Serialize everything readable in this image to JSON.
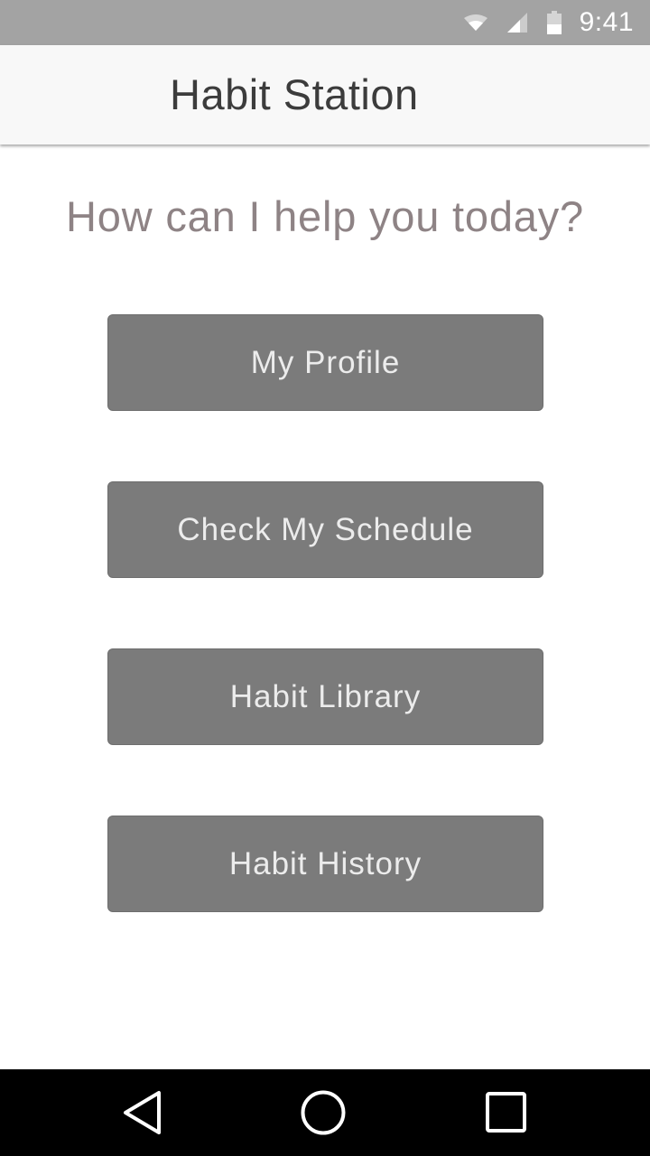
{
  "status_bar": {
    "time": "9:41",
    "icons": [
      "wifi-icon",
      "cell-signal-icon",
      "battery-icon"
    ]
  },
  "app_bar": {
    "title": "Habit Station"
  },
  "main": {
    "prompt": "How can I help you today?",
    "buttons": [
      {
        "label": "My Profile"
      },
      {
        "label": "Check My Schedule"
      },
      {
        "label": "Habit Library"
      },
      {
        "label": "Habit History"
      }
    ]
  },
  "nav_bar": {
    "buttons": [
      "back-icon",
      "home-icon",
      "recents-icon"
    ]
  },
  "colors": {
    "status_bar_bg": "#a3a3a3",
    "app_bar_bg": "#f8f8f8",
    "button_bg": "#7b7b7b",
    "button_text": "#ececec",
    "prompt_text": "#8e8385",
    "nav_bar_bg": "#000000"
  }
}
